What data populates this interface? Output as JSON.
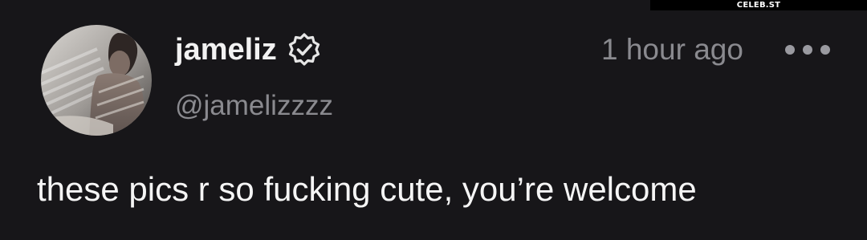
{
  "watermark": {
    "text": "CELEB.ST"
  },
  "post": {
    "author": {
      "display_name": "jameliz",
      "handle": "@jamelizzzz",
      "verified": true,
      "verified_icon": "verified-check-badge"
    },
    "timestamp": "1 hour ago",
    "more_icon": "ellipsis-horizontal",
    "text": "these pics r so fucking cute, you’re welcome"
  },
  "colors": {
    "background": "#171619",
    "primary_text": "#f2f2f2",
    "secondary_text": "#8a8a8f"
  }
}
